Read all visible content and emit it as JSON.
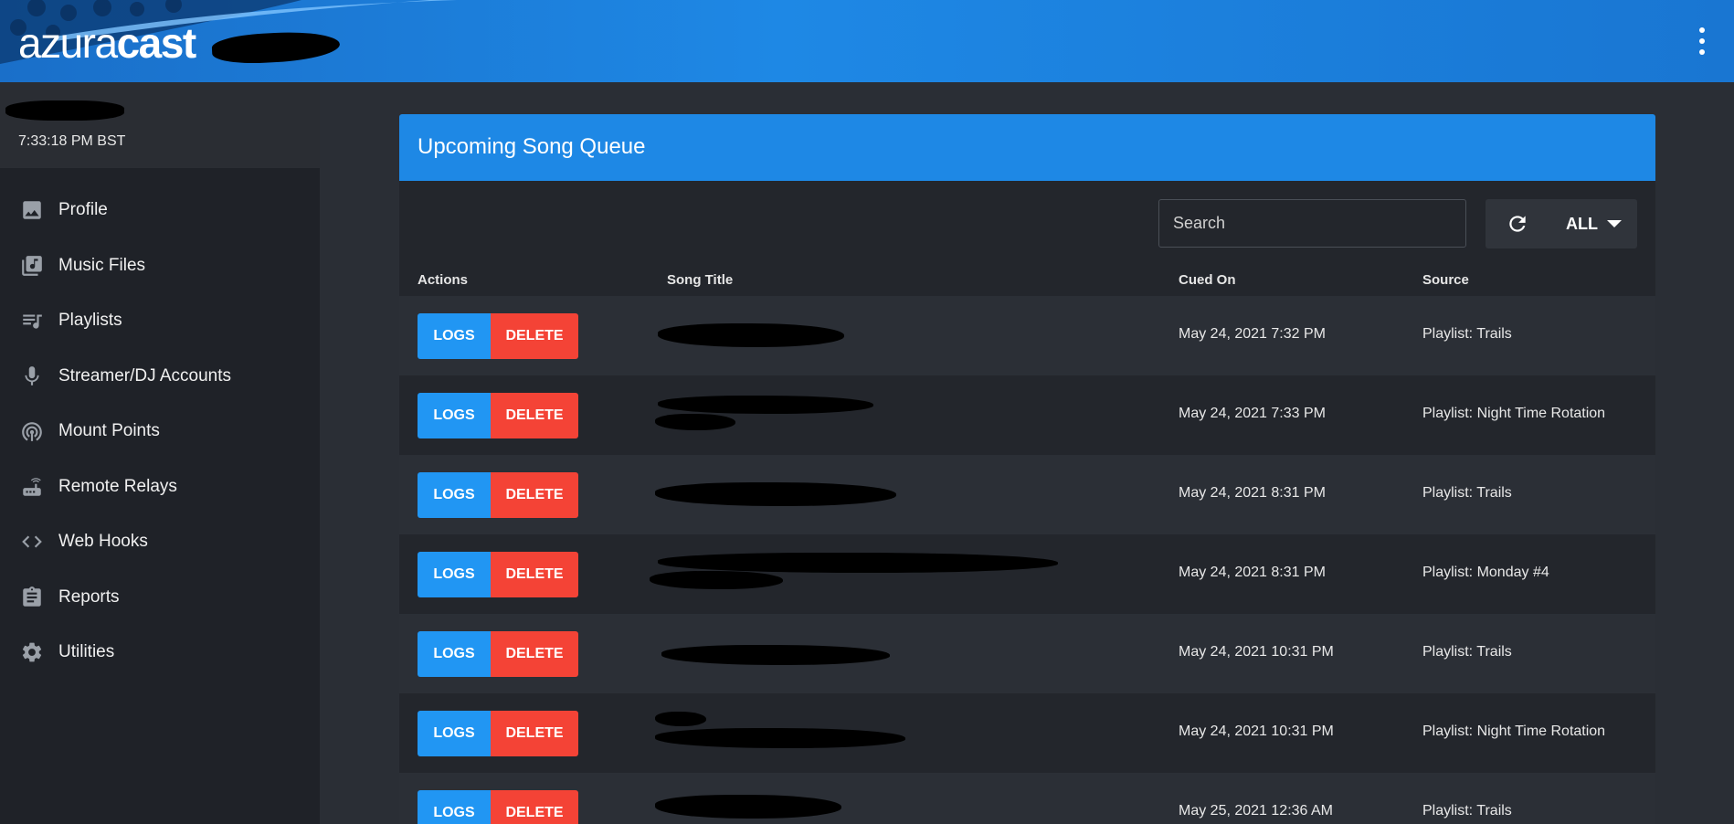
{
  "header": {
    "brand_light": "azura",
    "brand_bold": "cast"
  },
  "sidebar": {
    "station_time": "7:33:18 PM BST",
    "items": [
      {
        "label": "Profile",
        "icon": "image-icon"
      },
      {
        "label": "Music Files",
        "icon": "music-library-icon"
      },
      {
        "label": "Playlists",
        "icon": "playlist-icon"
      },
      {
        "label": "Streamer/DJ Accounts",
        "icon": "microphone-icon"
      },
      {
        "label": "Mount Points",
        "icon": "broadcast-icon"
      },
      {
        "label": "Remote Relays",
        "icon": "router-icon"
      },
      {
        "label": "Web Hooks",
        "icon": "code-icon"
      },
      {
        "label": "Reports",
        "icon": "clipboard-icon"
      },
      {
        "label": "Utilities",
        "icon": "gear-icon"
      }
    ]
  },
  "card": {
    "title": "Upcoming Song Queue",
    "search_placeholder": "Search",
    "filter_label": "ALL",
    "columns": {
      "actions": "Actions",
      "song_title": "Song Title",
      "cued_on": "Cued On",
      "source": "Source"
    },
    "logs_label": "LOGS",
    "delete_label": "DELETE",
    "rows": [
      {
        "cued_on": "May 24, 2021 7:32 PM",
        "source": "Playlist: Trails"
      },
      {
        "cued_on": "May 24, 2021 7:33 PM",
        "source": "Playlist: Night Time Rotation"
      },
      {
        "cued_on": "May 24, 2021 8:31 PM",
        "source": "Playlist: Trails"
      },
      {
        "cued_on": "May 24, 2021 8:31 PM",
        "source": "Playlist: Monday #4"
      },
      {
        "cued_on": "May 24, 2021 10:31 PM",
        "source": "Playlist: Trails"
      },
      {
        "cued_on": "May 24, 2021 10:31 PM",
        "source": "Playlist: Night Time Rotation"
      },
      {
        "cued_on": "May 25, 2021 12:36 AM",
        "source": "Playlist: Trails"
      }
    ]
  },
  "colors": {
    "primary": "#1e88e5",
    "logs": "#2196f3",
    "delete": "#f44336",
    "sidebar": "#1f2228",
    "background": "#2a2e35"
  }
}
